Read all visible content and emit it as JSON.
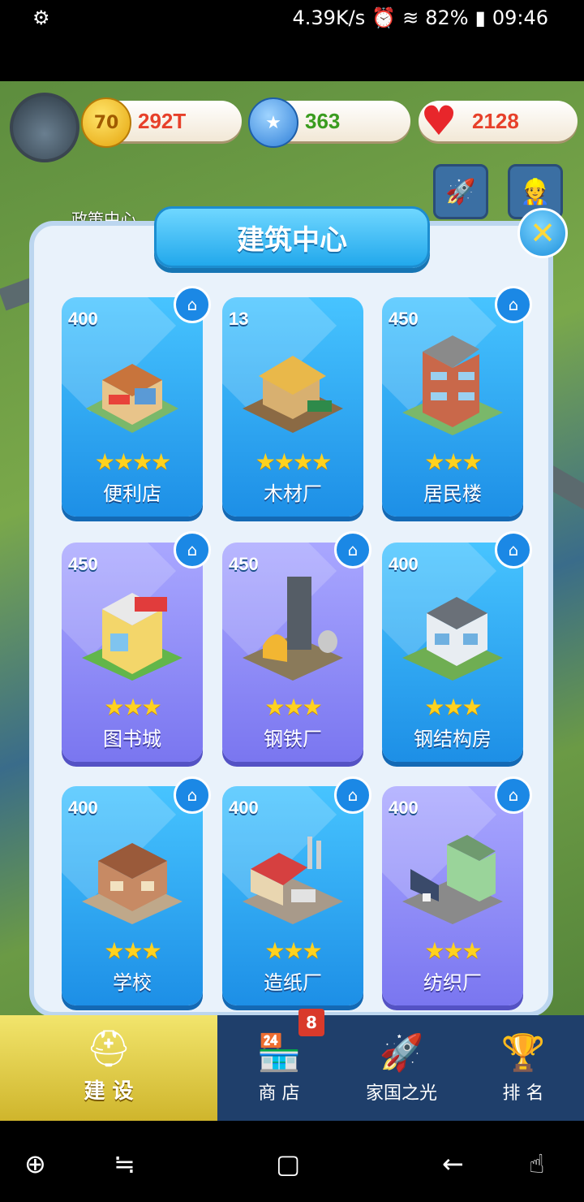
{
  "status_bar": {
    "speed": "4.39K/s",
    "battery": "82%",
    "time": "09:46"
  },
  "hud": {
    "coins": "292T",
    "gems": "363",
    "hearts": "2128",
    "coin_icon_text": "70",
    "policy_label": "政策中心"
  },
  "modal": {
    "title": "建筑中心",
    "close": "✕"
  },
  "buildings": [
    {
      "cost": "400",
      "name": "便利店",
      "stars": "★★★★"
    },
    {
      "cost": "13",
      "name": "木材厂",
      "stars": "★★★★"
    },
    {
      "cost": "450",
      "name": "居民楼",
      "stars": "★★★"
    },
    {
      "cost": "450",
      "name": "图书城",
      "stars": "★★★"
    },
    {
      "cost": "450",
      "name": "钢铁厂",
      "stars": "★★★"
    },
    {
      "cost": "400",
      "name": "钢结构房",
      "stars": "★★★"
    },
    {
      "cost": "400",
      "name": "学校",
      "stars": "★★★"
    },
    {
      "cost": "400",
      "name": "造纸厂",
      "stars": "★★★"
    },
    {
      "cost": "400",
      "name": "纺织厂",
      "stars": "★★★"
    }
  ],
  "nav": {
    "build": "建 设",
    "shop": "商 店",
    "glory": "家国之光",
    "rank": "排 名",
    "shop_badge": "8"
  },
  "icons": {
    "home": "home-icon",
    "star": "star-icon"
  },
  "colors": {
    "card_blue": "#1d8fe6",
    "card_purple": "#7a76f0",
    "accent": "#22a8ec"
  }
}
